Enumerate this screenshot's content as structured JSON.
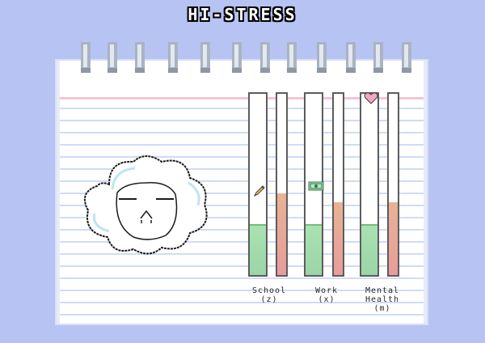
{
  "title": "HI-STRESS",
  "meters": [
    {
      "name": "School",
      "key": "(z)",
      "icon": "pencil-icon",
      "level": 0.28,
      "stress": 0.45
    },
    {
      "name": "Work",
      "key": "(x)",
      "icon": "money-bill-icon",
      "level": 0.28,
      "stress": 0.4
    },
    {
      "name": "Mental Health",
      "name_line1": "Mental",
      "name_line2": "Health",
      "key": "(m)",
      "icon": "heart-icon",
      "level": 0.28,
      "stress": 0.4
    }
  ],
  "colors": {
    "background": "#b7c3f3",
    "level_fill": "#9ad6a7",
    "stress_fill": "#e8a39a",
    "heart": "#f4a6c0"
  },
  "mascot": "cloud-face"
}
